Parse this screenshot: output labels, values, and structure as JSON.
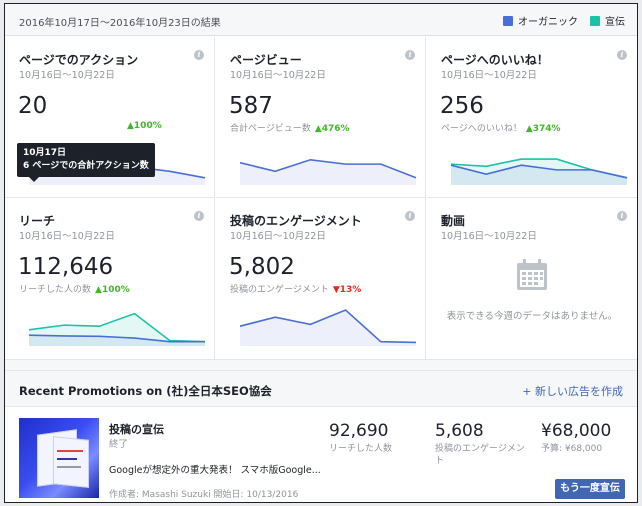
{
  "header": {
    "date_range": "2016年10月17日〜2016年10月23日の結果",
    "legend": [
      {
        "label": "オーガニック",
        "color": "#4a6fd4"
      },
      {
        "label": "宣伝",
        "color": "#1cc1a8"
      }
    ]
  },
  "colors": {
    "organic": "#4a6fd4",
    "paid": "#1cc1a8",
    "positive": "#42b72a",
    "negative": "#e02b20",
    "button": "#4267b2"
  },
  "cards": [
    {
      "title": "ページでのアクション",
      "date": "10月16日〜10月22日",
      "info": "i",
      "value": "20",
      "sub_label": "",
      "change": "100%",
      "direction": "up",
      "organic": [
        0.62,
        0.38,
        0.5,
        0.5,
        0.38,
        0.2
      ],
      "paid": null,
      "tooltip": {
        "date": "10月17日",
        "text": "6 ページでの合計アクション数"
      }
    },
    {
      "title": "ページビュー",
      "date": "10月16日〜10月22日",
      "info": "i",
      "value": "587",
      "sub_label": "合計ページビュー数",
      "change": "476%",
      "direction": "up",
      "organic": [
        0.62,
        0.38,
        0.7,
        0.58,
        0.58,
        0.2
      ],
      "paid": null
    },
    {
      "title": "ページへのいいね！",
      "date": "10月16日〜10月22日",
      "info": "i",
      "value": "256",
      "sub_label": "ページへのいいね！",
      "change": "374%",
      "direction": "up",
      "organic": [
        0.55,
        0.3,
        0.55,
        0.42,
        0.42,
        0.2
      ],
      "paid": [
        0.58,
        0.52,
        0.72,
        0.72,
        0.42,
        0.2
      ]
    },
    {
      "title": "リーチ",
      "date": "10月16日〜10月22日",
      "info": "i",
      "value": "112,646",
      "sub_label": "リーチした人の数",
      "change": "100%",
      "direction": "up",
      "organic": [
        0.3,
        0.28,
        0.27,
        0.22,
        0.12,
        0.12
      ],
      "paid": [
        0.45,
        0.58,
        0.55,
        0.9,
        0.15,
        0.12
      ]
    },
    {
      "title": "投稿のエンゲージメント",
      "date": "10月16日〜10月22日",
      "info": "i",
      "value": "5,802",
      "sub_label": "投稿のエンゲージメント",
      "change": "13%",
      "direction": "down",
      "organic": [
        0.55,
        0.8,
        0.6,
        1.0,
        0.12,
        0.1
      ],
      "paid": null
    },
    {
      "title": "動画",
      "date": "10月16日〜10月22日",
      "info": "i",
      "value": "",
      "sub_label": "",
      "change": "",
      "direction": "",
      "organic": null,
      "paid": null,
      "empty_text": "表示できる今週のデータはありません。",
      "empty_icon": "calendar-icon"
    }
  ],
  "promotions": {
    "title": "Recent Promotions on (社)全日本SEO協会",
    "new_ad": "+ 新しい広告を作成",
    "item": {
      "title": "投稿の宣伝",
      "status": "終了",
      "text": "Googleが想定外の重大発表！ スマホ版Google...",
      "meta": "作成者: Masashi Suzuki 開始日: 10/13/2016",
      "reach_value": "92,690",
      "reach_label": "リーチした人数",
      "engagement_value": "5,608",
      "engagement_label": "投稿のエンゲージメント",
      "budget_value": "¥68,000",
      "budget_label": "予算: ¥68,000",
      "button": "もう一度宣伝"
    }
  }
}
